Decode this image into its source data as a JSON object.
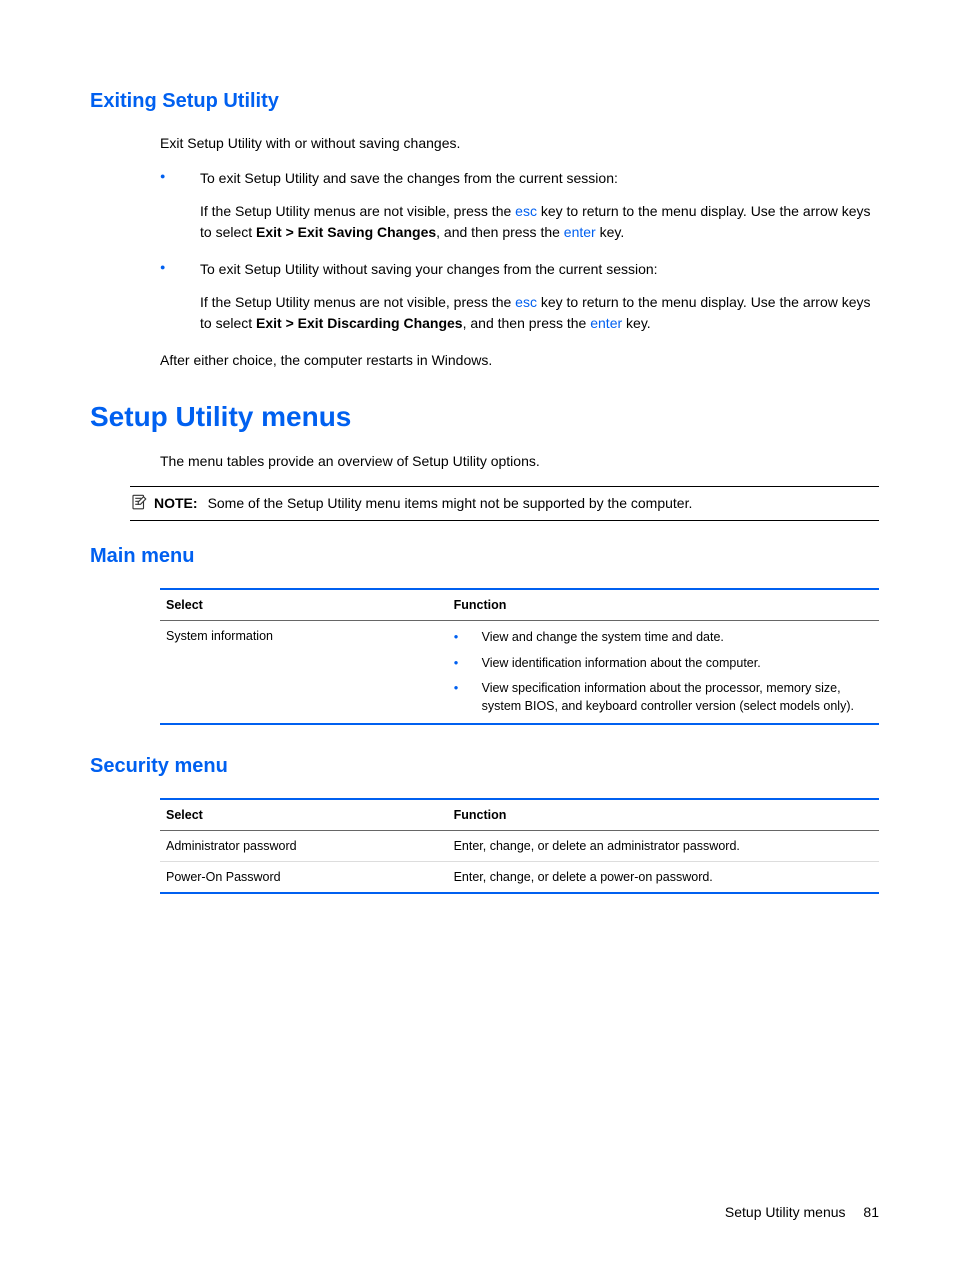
{
  "section1": {
    "heading": "Exiting Setup Utility",
    "intro": "Exit Setup Utility with or without saving changes.",
    "bullet1_lead": "To exit Setup Utility and save the changes from the current session:",
    "bullet1_sub_a": "If the Setup Utility menus are not visible, press the ",
    "bullet1_sub_b": "esc",
    "bullet1_sub_c": " key to return to the menu display. Use the arrow keys to select ",
    "bullet1_sub_d": "Exit > Exit Saving Changes",
    "bullet1_sub_e": ", and then press the ",
    "bullet1_sub_f": "enter",
    "bullet1_sub_g": " key.",
    "bullet2_lead": "To exit Setup Utility without saving your changes from the current session:",
    "bullet2_sub_a": "If the Setup Utility menus are not visible, press the ",
    "bullet2_sub_b": "esc",
    "bullet2_sub_c": " key to return to the menu display. Use the arrow keys to select ",
    "bullet2_sub_d": "Exit > Exit Discarding Changes",
    "bullet2_sub_e": ", and then press the ",
    "bullet2_sub_f": "enter",
    "bullet2_sub_g": " key.",
    "after": "After either choice, the computer restarts in Windows."
  },
  "section2": {
    "heading": "Setup Utility menus",
    "intro": "The menu tables provide an overview of Setup Utility options.",
    "note_label": "NOTE:",
    "note_text": "Some of the Setup Utility menu items might not be supported by the computer."
  },
  "main_menu": {
    "heading": "Main menu",
    "th_select": "Select",
    "th_function": "Function",
    "row1_select": "System information",
    "row1_fn1": "View and change the system time and date.",
    "row1_fn2": "View identification information about the computer.",
    "row1_fn3": "View specification information about the processor, memory size, system BIOS, and keyboard controller version (select models only)."
  },
  "security_menu": {
    "heading": "Security menu",
    "th_select": "Select",
    "th_function": "Function",
    "row1_select": "Administrator password",
    "row1_function": "Enter, change, or delete an administrator password.",
    "row2_select": "Power-On Password",
    "row2_function": "Enter, change, or delete a power-on password."
  },
  "footer": {
    "label": "Setup Utility menus",
    "page": "81"
  }
}
